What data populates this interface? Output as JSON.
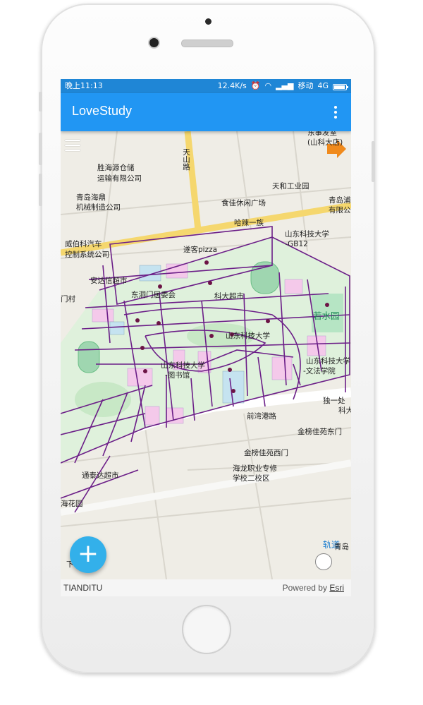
{
  "status": {
    "time": "晚上11:13",
    "speed": "12.4K/s",
    "carrier": "移动",
    "network": "4G"
  },
  "app": {
    "title": "LoveStudy",
    "overflow_icon": "more-vert-icon"
  },
  "map": {
    "labels": {
      "shengtaiyuan": "胜海源仓储",
      "shengtaiyuan2": "运输有限公司",
      "tianshanlu": "天山路",
      "dongshi": "东事发室",
      "shankeda": "(山科大店)",
      "qingdaohai": "青岛海鼎",
      "qingdaohai2": "机械制造公司",
      "tianhe": "天和工业园",
      "shishi": "食佳休闲广场",
      "qingdaopu": "青岛浦",
      "qingdaopu2": "有限公",
      "halayizu": "哈辣一族",
      "weibo": "威伯科汽车",
      "weibo2": "控制系统公司",
      "shandongkj": "山东科技大学",
      "gb12": "-GB12",
      "suike": "遂客pizza",
      "andaxin": "安达信超市",
      "menchun": "门村",
      "dongmen": "东洞门居委会",
      "kedachaoshi": "科大超市",
      "ruoshuiyuan": "若水园",
      "sdkj2": "山东科技大学",
      "sdkj_lib": "山东科技大学",
      "sdkj_lib2": "-图书馆",
      "sdkj_wf": "山东科技大学",
      "wenfa": "-文法学院",
      "duyi": "独一处",
      "keda": "科大",
      "qianwan": "前湾港路",
      "jinbang": "金榜佳苑东门",
      "jinbang_w": "金榜佳苑西门",
      "hailong": "海龙职业专修",
      "hailong2": "学校二校区",
      "tongtaida": "通泰达超市",
      "haihuayuan": "海花园",
      "guidao": "轨道",
      "qingdao_s": "青岛",
      "xia": "下"
    }
  },
  "fab": {
    "label": "+"
  },
  "attribution": {
    "left": "TIANDITU",
    "right_prefix": "Powered by",
    "right_link": "Esri"
  }
}
